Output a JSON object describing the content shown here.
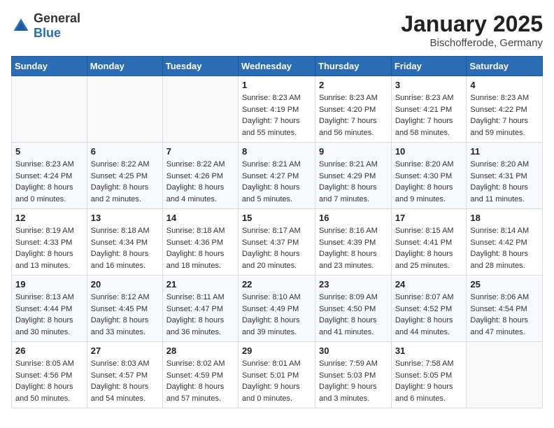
{
  "logo": {
    "general": "General",
    "blue": "Blue"
  },
  "title": "January 2025",
  "subtitle": "Bischofferode, Germany",
  "weekdays": [
    "Sunday",
    "Monday",
    "Tuesday",
    "Wednesday",
    "Thursday",
    "Friday",
    "Saturday"
  ],
  "weeks": [
    [
      {
        "day": "",
        "info": ""
      },
      {
        "day": "",
        "info": ""
      },
      {
        "day": "",
        "info": ""
      },
      {
        "day": "1",
        "info": "Sunrise: 8:23 AM\nSunset: 4:19 PM\nDaylight: 7 hours\nand 55 minutes."
      },
      {
        "day": "2",
        "info": "Sunrise: 8:23 AM\nSunset: 4:20 PM\nDaylight: 7 hours\nand 56 minutes."
      },
      {
        "day": "3",
        "info": "Sunrise: 8:23 AM\nSunset: 4:21 PM\nDaylight: 7 hours\nand 58 minutes."
      },
      {
        "day": "4",
        "info": "Sunrise: 8:23 AM\nSunset: 4:22 PM\nDaylight: 7 hours\nand 59 minutes."
      }
    ],
    [
      {
        "day": "5",
        "info": "Sunrise: 8:23 AM\nSunset: 4:24 PM\nDaylight: 8 hours\nand 0 minutes."
      },
      {
        "day": "6",
        "info": "Sunrise: 8:22 AM\nSunset: 4:25 PM\nDaylight: 8 hours\nand 2 minutes."
      },
      {
        "day": "7",
        "info": "Sunrise: 8:22 AM\nSunset: 4:26 PM\nDaylight: 8 hours\nand 4 minutes."
      },
      {
        "day": "8",
        "info": "Sunrise: 8:21 AM\nSunset: 4:27 PM\nDaylight: 8 hours\nand 5 minutes."
      },
      {
        "day": "9",
        "info": "Sunrise: 8:21 AM\nSunset: 4:29 PM\nDaylight: 8 hours\nand 7 minutes."
      },
      {
        "day": "10",
        "info": "Sunrise: 8:20 AM\nSunset: 4:30 PM\nDaylight: 8 hours\nand 9 minutes."
      },
      {
        "day": "11",
        "info": "Sunrise: 8:20 AM\nSunset: 4:31 PM\nDaylight: 8 hours\nand 11 minutes."
      }
    ],
    [
      {
        "day": "12",
        "info": "Sunrise: 8:19 AM\nSunset: 4:33 PM\nDaylight: 8 hours\nand 13 minutes."
      },
      {
        "day": "13",
        "info": "Sunrise: 8:18 AM\nSunset: 4:34 PM\nDaylight: 8 hours\nand 16 minutes."
      },
      {
        "day": "14",
        "info": "Sunrise: 8:18 AM\nSunset: 4:36 PM\nDaylight: 8 hours\nand 18 minutes."
      },
      {
        "day": "15",
        "info": "Sunrise: 8:17 AM\nSunset: 4:37 PM\nDaylight: 8 hours\nand 20 minutes."
      },
      {
        "day": "16",
        "info": "Sunrise: 8:16 AM\nSunset: 4:39 PM\nDaylight: 8 hours\nand 23 minutes."
      },
      {
        "day": "17",
        "info": "Sunrise: 8:15 AM\nSunset: 4:41 PM\nDaylight: 8 hours\nand 25 minutes."
      },
      {
        "day": "18",
        "info": "Sunrise: 8:14 AM\nSunset: 4:42 PM\nDaylight: 8 hours\nand 28 minutes."
      }
    ],
    [
      {
        "day": "19",
        "info": "Sunrise: 8:13 AM\nSunset: 4:44 PM\nDaylight: 8 hours\nand 30 minutes."
      },
      {
        "day": "20",
        "info": "Sunrise: 8:12 AM\nSunset: 4:45 PM\nDaylight: 8 hours\nand 33 minutes."
      },
      {
        "day": "21",
        "info": "Sunrise: 8:11 AM\nSunset: 4:47 PM\nDaylight: 8 hours\nand 36 minutes."
      },
      {
        "day": "22",
        "info": "Sunrise: 8:10 AM\nSunset: 4:49 PM\nDaylight: 8 hours\nand 39 minutes."
      },
      {
        "day": "23",
        "info": "Sunrise: 8:09 AM\nSunset: 4:50 PM\nDaylight: 8 hours\nand 41 minutes."
      },
      {
        "day": "24",
        "info": "Sunrise: 8:07 AM\nSunset: 4:52 PM\nDaylight: 8 hours\nand 44 minutes."
      },
      {
        "day": "25",
        "info": "Sunrise: 8:06 AM\nSunset: 4:54 PM\nDaylight: 8 hours\nand 47 minutes."
      }
    ],
    [
      {
        "day": "26",
        "info": "Sunrise: 8:05 AM\nSunset: 4:56 PM\nDaylight: 8 hours\nand 50 minutes."
      },
      {
        "day": "27",
        "info": "Sunrise: 8:03 AM\nSunset: 4:57 PM\nDaylight: 8 hours\nand 54 minutes."
      },
      {
        "day": "28",
        "info": "Sunrise: 8:02 AM\nSunset: 4:59 PM\nDaylight: 8 hours\nand 57 minutes."
      },
      {
        "day": "29",
        "info": "Sunrise: 8:01 AM\nSunset: 5:01 PM\nDaylight: 9 hours\nand 0 minutes."
      },
      {
        "day": "30",
        "info": "Sunrise: 7:59 AM\nSunset: 5:03 PM\nDaylight: 9 hours\nand 3 minutes."
      },
      {
        "day": "31",
        "info": "Sunrise: 7:58 AM\nSunset: 5:05 PM\nDaylight: 9 hours\nand 6 minutes."
      },
      {
        "day": "",
        "info": ""
      }
    ]
  ]
}
